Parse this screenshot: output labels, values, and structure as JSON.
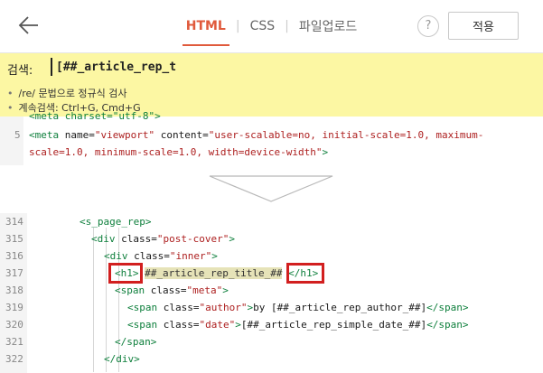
{
  "header": {
    "tabs": [
      {
        "label": "HTML",
        "active": true
      },
      {
        "label": "CSS",
        "active": false
      },
      {
        "label": "파일업로드",
        "active": false
      }
    ],
    "help_label": "?",
    "apply_label": "적용"
  },
  "search": {
    "label": "검색:",
    "value": "[##_article_rep_t",
    "hints": [
      "/re/ 문법으로 정규식 검사",
      "계속검색: Ctrl+G, Cmd+G"
    ]
  },
  "top_code": {
    "partial_line": "<meta charset=\"utf-8\">",
    "line_number": "5",
    "line_a": [
      "<meta ",
      "name=",
      "\"viewport\" ",
      "content=",
      "\"user-scalable=no, initial-scale=1.0, maximum-"
    ],
    "line_b": "scale=1.0, minimum-scale=1.0, width=device-width\"",
    "line_b_end": ">"
  },
  "bottom_code": {
    "rows": [
      {
        "num": "314",
        "indent": 88,
        "parts": [
          [
            "tag",
            "<s_page_rep>"
          ]
        ]
      },
      {
        "num": "315",
        "indent": 101,
        "parts": [
          [
            "tag",
            "<div "
          ],
          [
            "attr",
            "class="
          ],
          [
            "val",
            "\"post-cover\""
          ],
          [
            "tag",
            ">"
          ]
        ]
      },
      {
        "num": "316",
        "indent": 115,
        "parts": [
          [
            "tag",
            "<div "
          ],
          [
            "attr",
            "class="
          ],
          [
            "val",
            "\"inner\""
          ],
          [
            "tag",
            ">"
          ]
        ]
      },
      {
        "num": "317",
        "indent": 127,
        "parts": [
          [
            "tag",
            "<h1>"
          ],
          [
            "attr",
            " "
          ],
          [
            "hl",
            "##_article_rep_title_##"
          ],
          [
            "attr",
            " "
          ],
          [
            "tag",
            "</h1>"
          ]
        ]
      },
      {
        "num": "318",
        "indent": 127,
        "parts": [
          [
            "tag",
            "<span "
          ],
          [
            "attr",
            "class="
          ],
          [
            "val",
            "\"meta\""
          ],
          [
            "tag",
            ">"
          ]
        ]
      },
      {
        "num": "319",
        "indent": 141,
        "parts": [
          [
            "tag",
            "<span "
          ],
          [
            "attr",
            "class="
          ],
          [
            "val",
            "\"author\""
          ],
          [
            "tag",
            ">"
          ],
          [
            "attr",
            "by [##_article_rep_author_##]"
          ],
          [
            "tag",
            "</span>"
          ]
        ]
      },
      {
        "num": "320",
        "indent": 141,
        "parts": [
          [
            "tag",
            "<span "
          ],
          [
            "attr",
            "class="
          ],
          [
            "val",
            "\"date\""
          ],
          [
            "tag",
            ">"
          ],
          [
            "attr",
            "[##_article_rep_simple_date_##]"
          ],
          [
            "tag",
            "</span>"
          ]
        ]
      },
      {
        "num": "321",
        "indent": 127,
        "parts": [
          [
            "tag",
            "</span>"
          ]
        ]
      },
      {
        "num": "322",
        "indent": 115,
        "parts": [
          [
            "tag",
            "</div>"
          ]
        ]
      }
    ]
  },
  "icons": {
    "back": "back-arrow-icon",
    "down": "down-arrow-icon"
  }
}
